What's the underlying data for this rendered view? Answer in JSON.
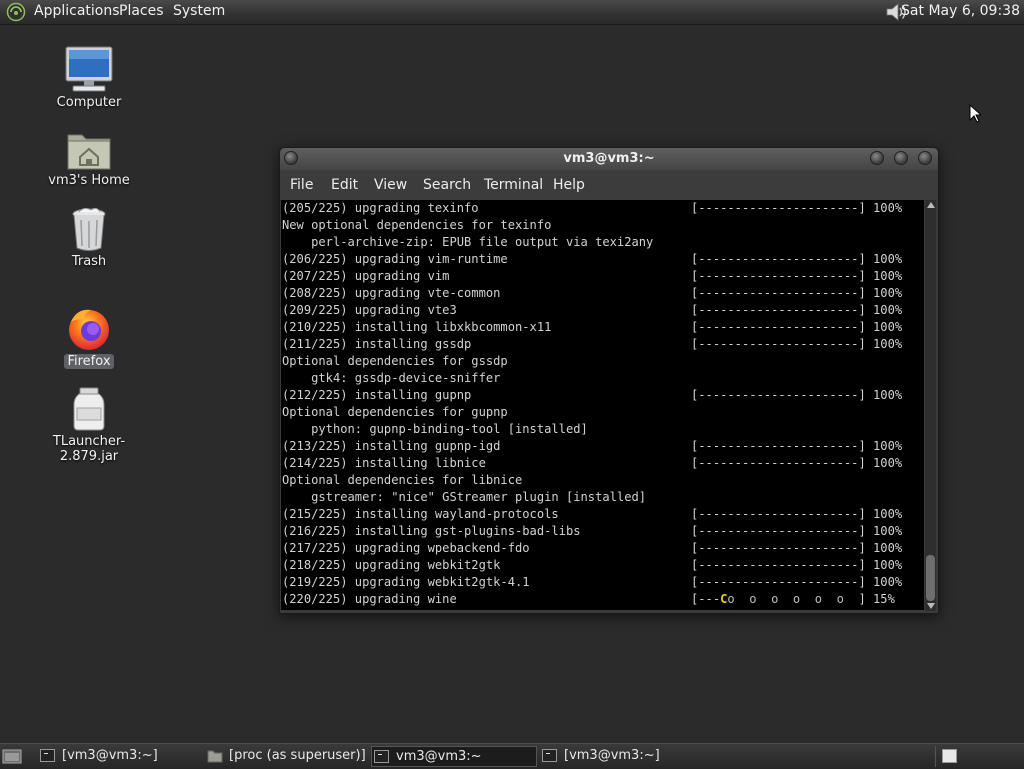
{
  "top_panel": {
    "menus": [
      "Applications",
      "Places",
      "System"
    ],
    "clock": "Sat May  6, 09:38"
  },
  "desktop_icons": [
    {
      "label": "Computer",
      "icon": "computer-icon"
    },
    {
      "label": "vm3's Home",
      "icon": "home-folder-icon"
    },
    {
      "label": "Trash",
      "icon": "trash-icon"
    },
    {
      "label": "Firefox",
      "icon": "firefox-icon"
    },
    {
      "label": "TLauncher-2.879.jar",
      "icon": "jar-file-icon"
    }
  ],
  "terminal": {
    "title": "vm3@vm3:~",
    "menu": [
      "File",
      "Edit",
      "View",
      "Search",
      "Terminal",
      "Help"
    ],
    "lines": [
      {
        "text": "(205/225) upgrading texinfo",
        "bar": "[----------------------] 100%"
      },
      {
        "text": "New optional dependencies for texinfo",
        "bar": ""
      },
      {
        "text": "    perl-archive-zip: EPUB file output via texi2any",
        "bar": ""
      },
      {
        "text": "(206/225) upgrading vim-runtime",
        "bar": "[----------------------] 100%"
      },
      {
        "text": "(207/225) upgrading vim",
        "bar": "[----------------------] 100%"
      },
      {
        "text": "(208/225) upgrading vte-common",
        "bar": "[----------------------] 100%"
      },
      {
        "text": "(209/225) upgrading vte3",
        "bar": "[----------------------] 100%"
      },
      {
        "text": "(210/225) installing libxkbcommon-x11",
        "bar": "[----------------------] 100%"
      },
      {
        "text": "(211/225) installing gssdp",
        "bar": "[----------------------] 100%"
      },
      {
        "text": "Optional dependencies for gssdp",
        "bar": ""
      },
      {
        "text": "    gtk4: gssdp-device-sniffer",
        "bar": ""
      },
      {
        "text": "(212/225) installing gupnp",
        "bar": "[----------------------] 100%"
      },
      {
        "text": "Optional dependencies for gupnp",
        "bar": ""
      },
      {
        "text": "    python: gupnp-binding-tool [installed]",
        "bar": ""
      },
      {
        "text": "(213/225) installing gupnp-igd",
        "bar": "[----------------------] 100%"
      },
      {
        "text": "(214/225) installing libnice",
        "bar": "[----------------------] 100%"
      },
      {
        "text": "Optional dependencies for libnice",
        "bar": ""
      },
      {
        "text": "    gstreamer: \"nice\" GStreamer plugin [installed]",
        "bar": ""
      },
      {
        "text": "(215/225) installing wayland-protocols",
        "bar": "[----------------------] 100%"
      },
      {
        "text": "(216/225) installing gst-plugins-bad-libs",
        "bar": "[----------------------] 100%"
      },
      {
        "text": "(217/225) upgrading wpebackend-fdo",
        "bar": "[----------------------] 100%"
      },
      {
        "text": "(218/225) upgrading webkit2gtk",
        "bar": "[----------------------] 100%"
      },
      {
        "text": "(219/225) upgrading webkit2gtk-4.1",
        "bar": "[----------------------] 100%"
      }
    ],
    "current": {
      "text": "(220/225) upgrading wine",
      "bar_start": "[---",
      "pacman": "C",
      "bar_dots": "o  o  o  o  o  o  ",
      "bar_end": "]",
      "percent": "15%"
    }
  },
  "taskbar": {
    "tasks": [
      {
        "label": "[vm3@vm3:~]",
        "icon": "terminal-icon",
        "active": false
      },
      {
        "label": "[proc (as superuser)]",
        "icon": "folder-icon",
        "active": false
      },
      {
        "label": "vm3@vm3:~",
        "icon": "terminal-icon",
        "active": true
      },
      {
        "label": "[vm3@vm3:~]",
        "icon": "terminal-icon",
        "active": false
      }
    ]
  },
  "colors": {
    "desktop": "#2b2b2b",
    "terminal_bg": "#000000",
    "terminal_fg": "#d2d2d2",
    "progress_pacman": "#e6d200"
  }
}
